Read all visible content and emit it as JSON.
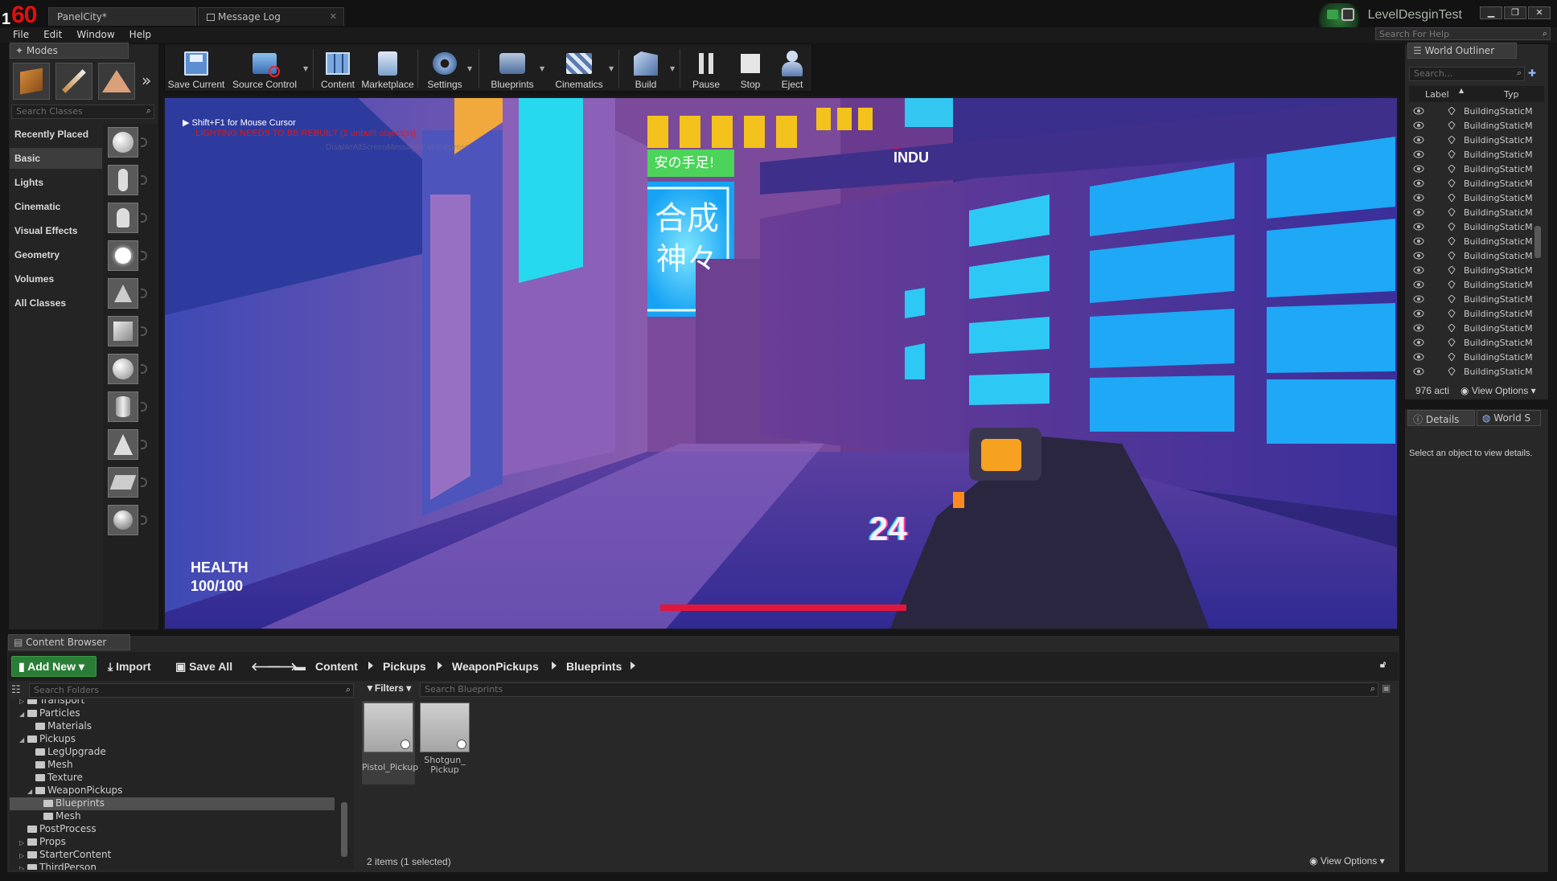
{
  "fps": {
    "one": "1",
    "value": "60"
  },
  "tabs": [
    {
      "label": "PanelCity*"
    },
    {
      "label": "Message Log"
    }
  ],
  "menu": [
    "File",
    "Edit",
    "Window",
    "Help"
  ],
  "project_name": "LevelDesginTest",
  "help_search": {
    "placeholder": "Search For Help"
  },
  "modes": {
    "tab_label": "Modes",
    "search_placeholder": "Search Classes",
    "categories": [
      "Recently Placed",
      "Basic",
      "Lights",
      "Cinematic",
      "Visual Effects",
      "Geometry",
      "Volumes",
      "All Classes"
    ],
    "selected_category": "Basic"
  },
  "toolbar": {
    "buttons": [
      {
        "label": "Save Current",
        "icon": "save-icon"
      },
      {
        "label": "Source Control",
        "icon": "source-control-icon"
      },
      {
        "label": "Content",
        "icon": "content-icon"
      },
      {
        "label": "Marketplace",
        "icon": "marketplace-icon"
      },
      {
        "label": "Settings",
        "icon": "settings-icon"
      },
      {
        "label": "Blueprints",
        "icon": "blueprints-icon"
      },
      {
        "label": "Cinematics",
        "icon": "cinematics-icon"
      },
      {
        "label": "Build",
        "icon": "build-icon"
      },
      {
        "label": "Pause",
        "icon": "pause-icon"
      },
      {
        "label": "Stop",
        "icon": "stop-icon"
      },
      {
        "label": "Eject",
        "icon": "eject-icon"
      }
    ]
  },
  "viewport": {
    "mouse_hint": "Shift+F1 for Mouse Cursor",
    "lighting_warning": "LIGHTING NEEDS TO BE REBUILT (2 unbuilt object(s))",
    "suppress_hint": "DisableAllScreenMessages' to suppress",
    "sign_text_1": "合成",
    "sign_text_2": "神々",
    "sign_green": "安の手足!",
    "sign_red": "INDU",
    "health_label": "HEALTH",
    "health_value": "100/100",
    "ammo": "24",
    "health_bar_fill": 1.0
  },
  "world_outliner": {
    "tab_label": "World Outliner",
    "search_placeholder": "Search...",
    "col_label": "Label",
    "col_type": "Typ",
    "row_text": "BuildingStaticM",
    "row_count": 19,
    "actors": "976 acti",
    "view_options": "View Options"
  },
  "details": {
    "tab_details": "Details",
    "tab_world": "World S",
    "empty_message": "Select an object to view details."
  },
  "content_browser": {
    "tab_label": "Content Browser",
    "add_new": "Add New",
    "import": "Import",
    "save_all": "Save All",
    "breadcrumb": [
      "Content",
      "Pickups",
      "WeaponPickups",
      "Blueprints"
    ],
    "folder_search_placeholder": "Search Folders",
    "filters": "Filters",
    "asset_search_placeholder": "Search Blueprints",
    "tree": [
      {
        "label": "Transport",
        "depth": 1,
        "expander": "right"
      },
      {
        "label": "Particles",
        "depth": 1,
        "expander": "down"
      },
      {
        "label": "Materials",
        "depth": 2,
        "expander": ""
      },
      {
        "label": "Pickups",
        "depth": 1,
        "expander": "down"
      },
      {
        "label": "LegUpgrade",
        "depth": 2,
        "expander": ""
      },
      {
        "label": "Mesh",
        "depth": 2,
        "expander": ""
      },
      {
        "label": "Texture",
        "depth": 2,
        "expander": ""
      },
      {
        "label": "WeaponPickups",
        "depth": 2,
        "expander": "down"
      },
      {
        "label": "Blueprints",
        "depth": 3,
        "expander": "",
        "selected": true
      },
      {
        "label": "Mesh",
        "depth": 3,
        "expander": ""
      },
      {
        "label": "PostProcess",
        "depth": 1,
        "expander": ""
      },
      {
        "label": "Props",
        "depth": 1,
        "expander": "right"
      },
      {
        "label": "StarterContent",
        "depth": 1,
        "expander": "right"
      },
      {
        "label": "ThirdPerson",
        "depth": 1,
        "expander": "right"
      }
    ],
    "assets": [
      {
        "label": "Pistol_Pickup",
        "selected": true
      },
      {
        "label": "Shotgun_ Pickup",
        "selected": false
      }
    ],
    "status": "2 items (1 selected)",
    "view_options": "View Options"
  },
  "colors": {
    "accent_green": "#2a7d36",
    "warning_red": "#e01010",
    "selection": "#3d3d3d"
  }
}
